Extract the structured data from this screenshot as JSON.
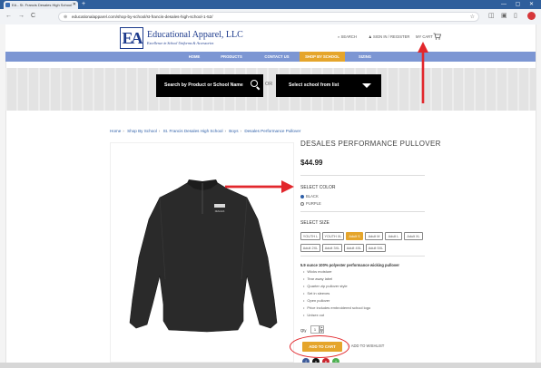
{
  "browser": {
    "tab_title": "EA - St. Francis Desales High School",
    "url": "educationalapparel.com/shop-by-school/st-francis-desales-high-school-1-52/",
    "new_tab": "+",
    "window_controls": "— ▢ ✕",
    "back": "←",
    "forward": "→",
    "reload": "C"
  },
  "header": {
    "logo_mark": "EA",
    "logo_name": "Educational Apparel, LLC",
    "logo_tagline": "Excellence in School Uniforms & Accessories",
    "search_link": "SEARCH",
    "signin_link": "SIGN IN / REGISTER",
    "cart_link": "MY CART"
  },
  "nav": {
    "items": [
      {
        "label": "HOME"
      },
      {
        "label": "PRODUCTS"
      },
      {
        "label": "CONTACT US"
      },
      {
        "label": "SHOP BY SCHOOL"
      },
      {
        "label": "SIZING"
      }
    ]
  },
  "search_band": {
    "product_search_label": "Search by Product or School Name",
    "or_text": "OR",
    "school_select_label": "Select school from list"
  },
  "breadcrumb": {
    "items": [
      "Home",
      "Shop By School",
      "St. Francis Desales High School",
      "Boys",
      "Desales Performance Pullover"
    ]
  },
  "product": {
    "title": "DESALES PERFORMANCE PULLOVER",
    "price": "$44.99",
    "color_label": "SELECT COLOR",
    "colors": [
      "BLACK",
      "PURPLE"
    ],
    "size_label": "SELECT SIZE",
    "sizes_row1": [
      "YOUTH L",
      "YOUTH XL",
      "Adult S",
      "Adult M",
      "Adult L",
      "Adult XL"
    ],
    "sizes_row2": [
      "Adult 2XL",
      "Adult 3XL",
      "Adult 4XL",
      "Adult 5XL"
    ],
    "description_heading": "5.9 ounce 100% polyester performance wicking pullover",
    "bullets": [
      "Wicks moisture",
      "Tear away label",
      "Quarter zip pullover style",
      "Set in sleeves",
      "Open pullover",
      "Price includes embroidered school logo",
      "Unisex cut"
    ],
    "qty_label": "Qty",
    "qty_value": "1",
    "add_to_cart": "ADD TO CART",
    "wishlist": "ADD TO WISHLIST",
    "garment_logo": "DESALES"
  },
  "colors": {
    "accent_orange": "#e5a52b",
    "nav_blue": "#7c96d3",
    "brand_blue": "#1c3a8c",
    "annotation_red": "#e2272c"
  }
}
